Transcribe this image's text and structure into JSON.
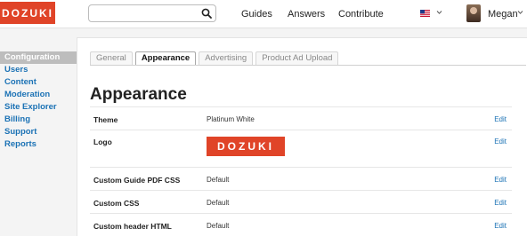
{
  "brand": {
    "logo_text": "DOZUKI",
    "color": "#e04428"
  },
  "topbar": {
    "search": {
      "value": "",
      "placeholder": ""
    },
    "links": [
      "Guides",
      "Answers",
      "Contribute"
    ],
    "language_icon": "us-flag-icon",
    "user_name": "Megan"
  },
  "sidebar": {
    "items": [
      {
        "label": "Configuration",
        "active": true
      },
      {
        "label": "Users",
        "active": false
      },
      {
        "label": "Content",
        "active": false
      },
      {
        "label": "Moderation",
        "active": false
      },
      {
        "label": "Site Explorer",
        "active": false
      },
      {
        "label": "Billing",
        "active": false
      },
      {
        "label": "Support",
        "active": false
      },
      {
        "label": "Reports",
        "active": false
      }
    ]
  },
  "main": {
    "tabs": [
      {
        "label": "General",
        "active": false
      },
      {
        "label": "Appearance",
        "active": true
      },
      {
        "label": "Advertising",
        "active": false
      },
      {
        "label": "Product Ad Upload",
        "active": false
      }
    ],
    "title": "Appearance",
    "rows": [
      {
        "label": "Theme",
        "value": "Platinum White",
        "action": "Edit"
      },
      {
        "label": "Logo",
        "value": "",
        "logo_text": "DOZUKI",
        "action": "Edit"
      },
      {
        "label": "Custom Guide PDF CSS",
        "value": "Default",
        "action": "Edit"
      },
      {
        "label": "Custom CSS",
        "value": "Default",
        "action": "Edit"
      },
      {
        "label": "Custom header HTML",
        "value": "Default",
        "action": "Edit"
      }
    ]
  },
  "colors": {
    "link": "#1b72b5",
    "active_sidebar_bg": "#bdbdbd"
  }
}
